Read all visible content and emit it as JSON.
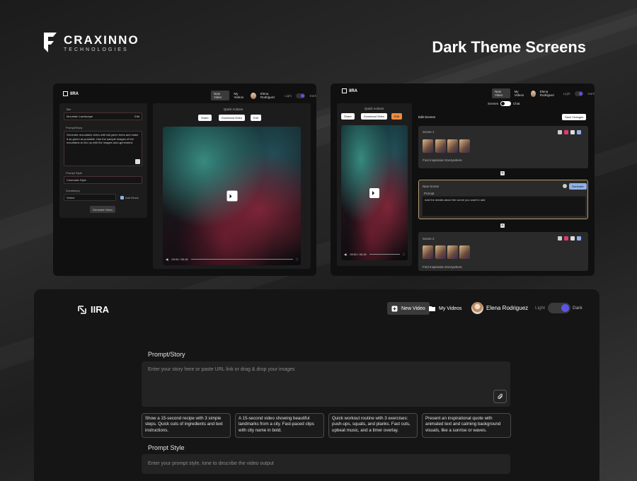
{
  "branding": {
    "company": "CRAXINNO",
    "company_sub": "TECHNOLOGIES",
    "headline": "Dark Theme Screens"
  },
  "app": {
    "name": "IIRA"
  },
  "nav": {
    "new_video": "New Video",
    "my_videos": "My Videos",
    "user_name": "Elena Rodriguez",
    "theme_light": "Light",
    "theme_dark": "Dark",
    "theme_value": "Dark"
  },
  "screen1": {
    "title_label": "Title",
    "title_value": "Mountain Landscape",
    "edit": "Edit",
    "prompt_label": "Prompt/Story",
    "prompt_value": "Generate mountains video with tall green trees and make it as green as possible. Use the sample images of the mountains to mix up with the images auto-generated.",
    "style_label": "Prompt Style",
    "style_value": "Cinematic Style",
    "duration_label": "Duration(s)",
    "duration_value": "Select",
    "add_music": "Add Music",
    "generate": "Generate Video",
    "quick_actions": "Quick Actions",
    "share": "Share",
    "download": "Download Video",
    "time": "00:00 / 00:40"
  },
  "screen2": {
    "quick_actions": "Quick Actions",
    "share": "Share",
    "download": "Download Video",
    "edit": "Edit",
    "time": "00:00 / 00:40",
    "scenes_label": "Scenes",
    "chat_label": "Chat",
    "edit_scenes": "Edit Scenes",
    "save_changes": "Save Changes",
    "scene1": {
      "title": "Scene 1",
      "caption": "Find Inspiration Everywhere"
    },
    "new_scene": {
      "title": "New Scene",
      "generate": "Generate",
      "prompt_label": "Prompt",
      "prompt_value": "Add the details about the scene you want to add"
    },
    "scene2": {
      "title": "Scene 2",
      "caption": "Find Inspiration Everywhere"
    }
  },
  "main": {
    "prompt_title": "Prompt/Story",
    "prompt_placeholder": "Enter your story here or paste URL link or drag & drop your images",
    "suggestions": [
      "Show a 15-second recipe with 3 simple steps. Quick cuts of ingredients and text instructions.",
      "A 15-second video showing beautiful landmarks from a city. Fast-paced clips with city name in bold.",
      "Quick workout routine with 3 exercises: push-ups, squats, and planks. Fast cuts, upbeat music, and a timer overlay.",
      "Present an inspirational quote with animated text and calming background visuals, like a sunrise or waves."
    ],
    "style_title": "Prompt Style",
    "style_placeholder": "Enter your prompt style, tone to describe the video output"
  },
  "colors": {
    "accent": "#5b55e6",
    "orange": "#f08a3c",
    "background": "#151515"
  },
  "icons": [
    "brand-logo-icon",
    "app-logo-icon",
    "new-video-icon",
    "folder-icon",
    "attach-icon",
    "play-icon",
    "volume-icon",
    "fullscreen-icon",
    "share-icon",
    "download-icon",
    "edit-icon"
  ]
}
